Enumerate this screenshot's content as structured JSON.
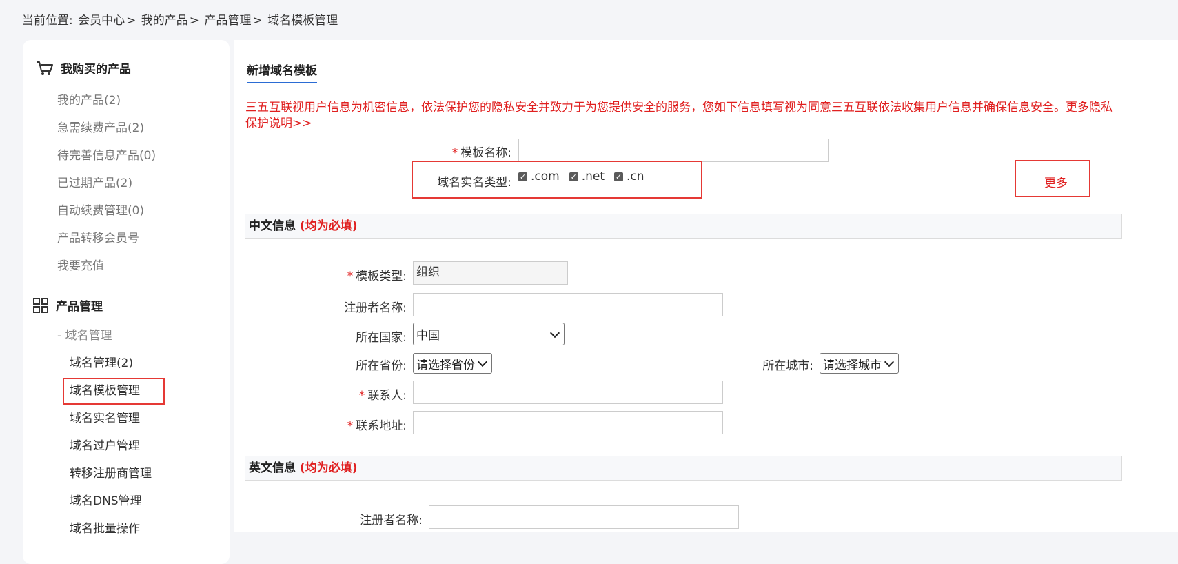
{
  "breadcrumb": {
    "prefix": "当前位置:",
    "items": [
      "会员中心",
      "我的产品",
      "产品管理",
      "域名模板管理"
    ],
    "separator": ">"
  },
  "sidebar": {
    "section1": {
      "icon": "cart-icon",
      "title": "我购买的产品",
      "items": [
        "我的产品(2)",
        "急需续费产品(2)",
        "待完善信息产品(0)",
        "已过期产品(2)",
        "自动续费管理(0)",
        "产品转移会员号",
        "我要充值"
      ]
    },
    "section2": {
      "icon": "grid-icon",
      "title": "产品管理",
      "group": "- 域名管理",
      "items": [
        "域名管理(2)",
        "域名模板管理",
        "域名实名管理",
        "域名过户管理",
        "转移注册商管理",
        "域名DNS管理",
        "域名批量操作"
      ],
      "active_index": 1
    }
  },
  "main": {
    "tab_title": "新增域名模板",
    "notice_text": "三五互联视用户信息为机密信息，依法保护您的隐私安全并致力于为您提供安全的服务，您如下信息填写视为同意三五互联依法收集用户信息并确保信息安全。",
    "notice_link": "更多隐私保护说明>>",
    "template_name": {
      "label": "模板名称:",
      "value": ""
    },
    "realname_type": {
      "label": "域名实名类型:",
      "options": [
        ".com",
        ".net",
        ".cn"
      ],
      "checked": [
        true,
        true,
        true
      ]
    },
    "more_link": "更多",
    "cn_section": {
      "title": "中文信息",
      "must": "(均为必填)",
      "template_type": {
        "label": "模板类型:",
        "value": "组织"
      },
      "registrant": {
        "label": "注册者名称:",
        "value": ""
      },
      "country": {
        "label": "所在国家:",
        "value": "中国"
      },
      "province": {
        "label": "所在省份:",
        "value": "请选择省份"
      },
      "city": {
        "label": "所在城市:",
        "value": "请选择城市"
      },
      "contact": {
        "label": "联系人:",
        "value": ""
      },
      "address": {
        "label": "联系地址:",
        "value": ""
      }
    },
    "en_section": {
      "title": "英文信息",
      "must": "(均为必填)",
      "registrant": {
        "label": "注册者名称:",
        "value": ""
      }
    }
  },
  "colors": {
    "accent_red": "#e02020",
    "tab_blue": "#2b6cd4",
    "highlight_box": "#e53935"
  }
}
